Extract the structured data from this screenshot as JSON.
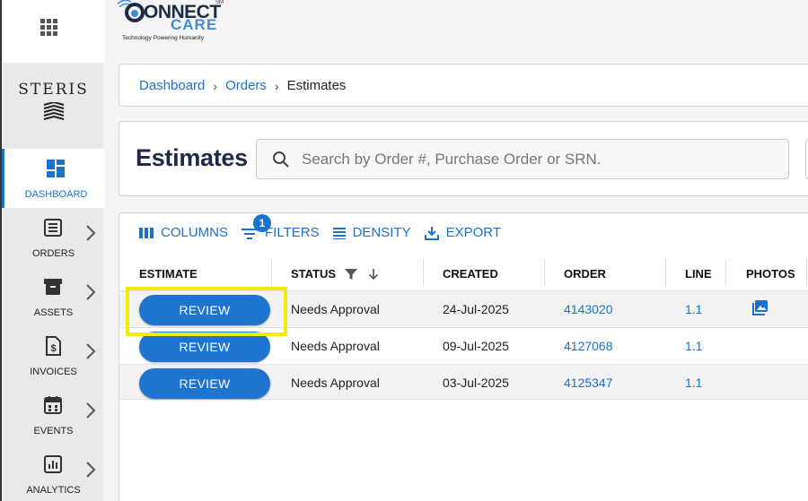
{
  "logo": {
    "connect": "ONNECT",
    "connect_c": "C",
    "care": "CARE",
    "sm": "SM",
    "tagline": "Technology Powering Humanity"
  },
  "brand": {
    "steris": "STERIS"
  },
  "sidebar": {
    "items": [
      {
        "label": "DASHBOARD",
        "icon": "dashboard-icon",
        "active": true
      },
      {
        "label": "ORDERS",
        "icon": "orders-icon"
      },
      {
        "label": "ASSETS",
        "icon": "assets-icon"
      },
      {
        "label": "INVOICES",
        "icon": "invoices-icon"
      },
      {
        "label": "EVENTS",
        "icon": "events-icon"
      },
      {
        "label": "ANALYTICS",
        "icon": "analytics-icon"
      }
    ]
  },
  "breadcrumb": {
    "items": [
      "Dashboard",
      "Orders"
    ],
    "current": "Estimates"
  },
  "page": {
    "title": "Estimates"
  },
  "search": {
    "placeholder": "Search by Order #, Purchase Order or SRN.",
    "value": ""
  },
  "toolbar": {
    "columns": "COLUMNS",
    "filters": "FILTERS",
    "filter_count": "1",
    "density": "DENSITY",
    "export": "EXPORT"
  },
  "table": {
    "headers": {
      "estimate": "ESTIMATE",
      "status": "STATUS",
      "created": "CREATED",
      "order": "ORDER",
      "line": "LINE",
      "photos": "PHOTOS"
    },
    "rows": [
      {
        "estimate": "REVIEW",
        "status": "Needs Approval",
        "created": "24-Jul-2025",
        "order": "4143020",
        "line": "1.1",
        "has_photo": true
      },
      {
        "estimate": "REVIEW",
        "status": "Needs Approval",
        "created": "09-Jul-2025",
        "order": "4127068",
        "line": "1.1",
        "has_photo": false
      },
      {
        "estimate": "REVIEW",
        "status": "Needs Approval",
        "created": "03-Jul-2025",
        "order": "4125347",
        "line": "1.1",
        "has_photo": false
      }
    ]
  },
  "colors": {
    "accent": "#1a73c9",
    "title": "#1d2a4a",
    "highlight": "#f2ea0c"
  }
}
